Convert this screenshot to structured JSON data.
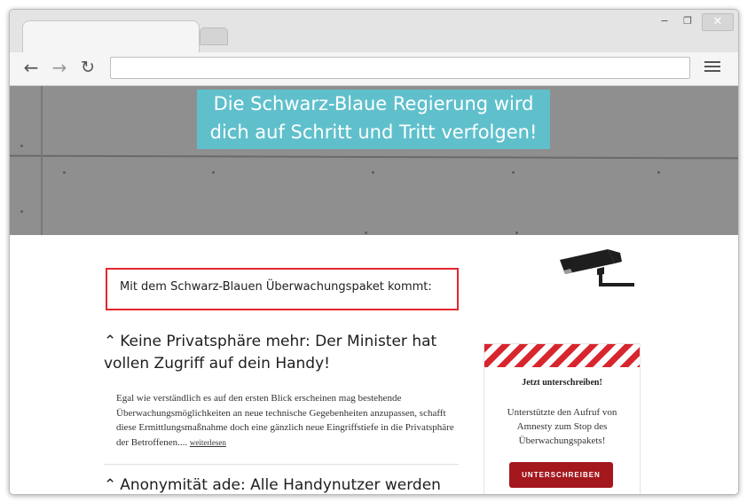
{
  "browser": {
    "tab_title": "",
    "url": "",
    "window_controls": {
      "minimize_icon": "minimize-icon",
      "maximize_icon": "maximize-icon",
      "close_icon": "close-icon"
    },
    "nav": {
      "back_icon": "arrow-left-icon",
      "forward_icon": "arrow-right-icon",
      "reload_icon": "reload-icon",
      "menu_icon": "hamburger-menu-icon"
    }
  },
  "hero": {
    "banner_line1": "Die Schwarz-Blaue Regierung wird",
    "banner_line2": "dich auf Schritt und Tritt verfolgen!",
    "banner_color": "#5fc0cc"
  },
  "main": {
    "callout_text": "Mit dem Schwarz-Blauen Überwachungspaket kommt:",
    "callout_border_color": "#e3262e",
    "camera_icon": "surveillance-camera-icon",
    "articles": [
      {
        "chevron": "⌃",
        "title_line1": "Keine Privatsphäre mehr: Der Minister hat",
        "title_line2": "vollen Zugriff auf dein Handy!",
        "body": "Egal wie verständlich es auf den ersten Blick erscheinen mag bestehende Überwachungsmöglichkeiten an neue technische Gegebenheiten anzupassen, schafft diese Ermittlungsmaßnahme doch eine gänzlich neue Eingriffstiefe in die Privatsphäre der Betroffenen....",
        "read_more": "weiterlesen"
      },
      {
        "chevron": "⌃",
        "title_line1": "Anonymität ade: Alle Handynutzer werden"
      }
    ]
  },
  "sidebar": {
    "title": "Jetzt unterschreiben!",
    "text": "Unterstützte den Aufruf von Amnesty zum Stop des Überwachungspakets!",
    "button_label": "UNTERSCHREIBEN",
    "button_color": "#a3171d",
    "stripe_color": "#d8262f"
  }
}
